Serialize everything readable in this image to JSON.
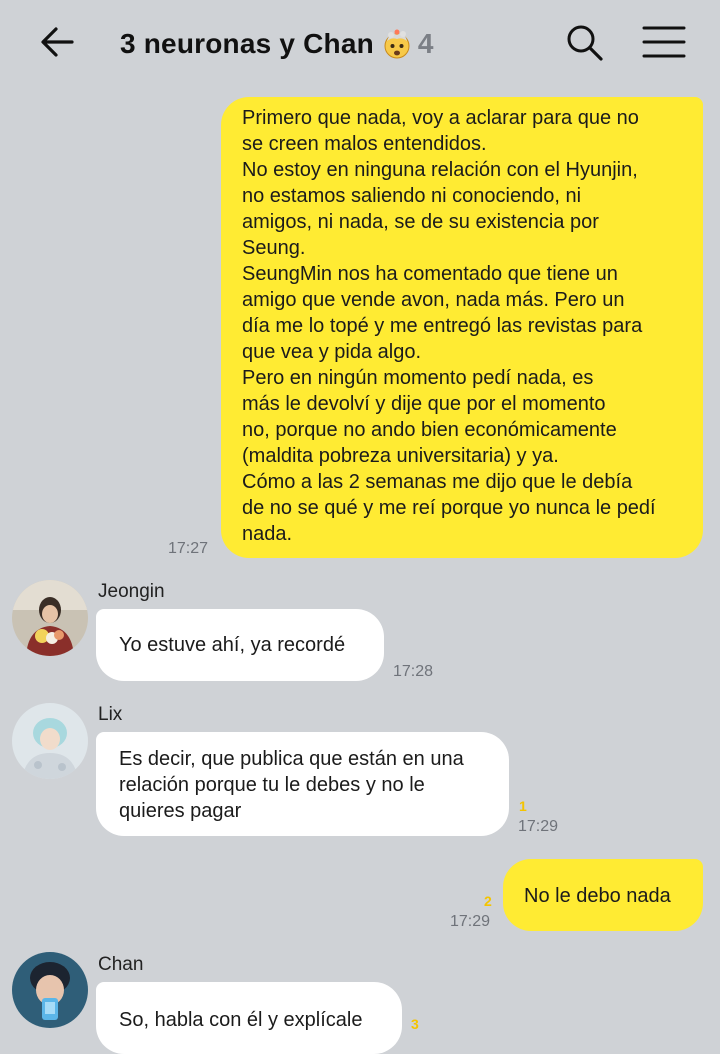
{
  "header": {
    "title": "3 neuronas y Chan",
    "member_count": "4"
  },
  "messages": {
    "m1": {
      "text": "Primero que nada, voy a aclarar para que no\nse creen malos entendidos.\nNo estoy en ninguna relación con el Hyunjin,\nno estamos saliendo ni conociendo, ni\namigos, ni nada, se de su existencia por\nSeung.\nSeungMin nos ha comentado que tiene un\namigo que vende avon, nada más. Pero un\ndía me lo topé y me entregó las revistas para\nque vea y pida algo.\nPero en ningún momento pedí nada, es\nmás le devolví y dije que por el momento\nno, porque no ando bien económicamente\n(maldita pobreza universitaria) y ya.\nCómo a las 2 semanas me dijo que le debía\nde no se qué y me reí porque yo nunca le pedí\nnada.",
      "time": "17:27"
    },
    "m2": {
      "sender": "Jeongin",
      "text": "Yo estuve ahí, ya recordé",
      "time": "17:28"
    },
    "m3": {
      "sender": "Lix",
      "text": "Es decir, que publica que están en una\nrelación porque tu le debes y no le\nquieres pagar",
      "unread": "1",
      "time": "17:29"
    },
    "m4": {
      "text": "No le debo nada",
      "unread": "2",
      "time": "17:29"
    },
    "m5": {
      "sender": "Chan",
      "text": "So, habla con él y explícale",
      "unread": "3"
    }
  },
  "colors": {
    "background": "#cfd2d6",
    "outgoing_bubble": "#ffeb33",
    "incoming_bubble": "#ffffff",
    "unread": "#f4c400"
  },
  "icons": {
    "back": "arrow-left-icon",
    "search": "search-icon",
    "menu": "hamburger-menu-icon",
    "title_emoji": "exploding-head-emoji"
  }
}
